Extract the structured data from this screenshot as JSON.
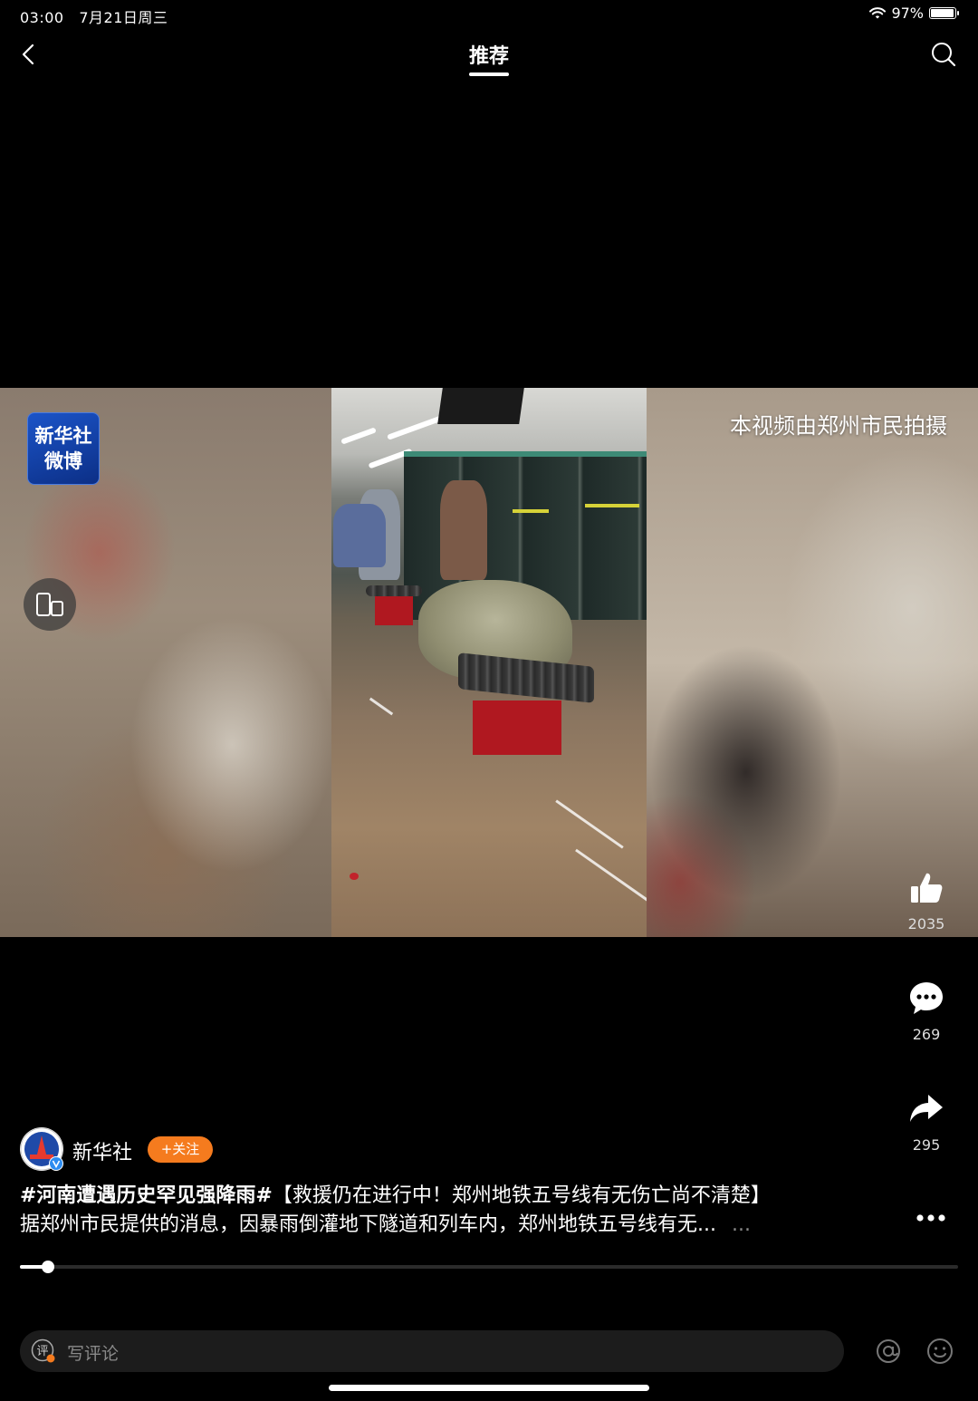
{
  "status_bar": {
    "time": "03:00",
    "date": "7月21日周三",
    "battery_text": "97%",
    "battery_level": 0.97
  },
  "nav": {
    "title": "推荐",
    "back_icon": "chevron-left-icon",
    "search_icon": "search-icon"
  },
  "video": {
    "badge_line1": "新华社",
    "badge_line2": "微博",
    "caption": "本视频由郑州市民拍摄",
    "rotate_icon": "rotate-screen-icon"
  },
  "actions": {
    "like_count": "2035",
    "comment_count": "269",
    "share_count": "295"
  },
  "author": {
    "name": "新华社",
    "follow_label": "+关注",
    "verified": true
  },
  "description": {
    "hashtag": "#河南遭遇历史罕见强降雨#",
    "headline": "【救援仍在进行中！郑州地铁五号线有无伤亡尚不清楚】",
    "body": "据郑州市民提供的消息，因暴雨倒灌地下隧道和列车内，郑州地铁五号线有无...",
    "ellipsis": "..."
  },
  "playback": {
    "progress": 0.03
  },
  "comment_bar": {
    "icon_text": "评",
    "placeholder": "写评论"
  },
  "colors": {
    "follow": "#f57b1e",
    "badge": "#1b54c8",
    "background": "#000000"
  }
}
